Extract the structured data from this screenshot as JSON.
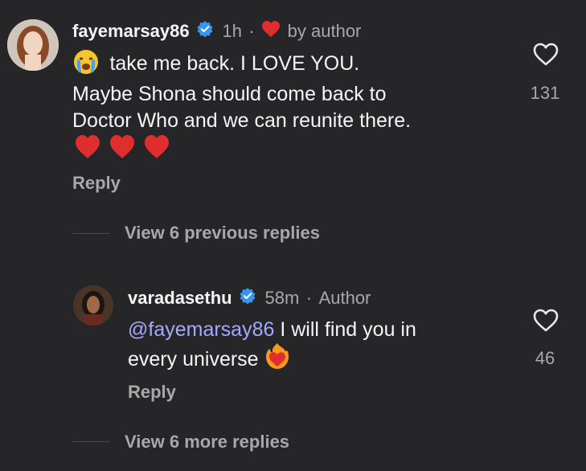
{
  "comment": {
    "username": "fayemarsay86",
    "time": "1h",
    "separator": "·",
    "liked_by_author": "by author",
    "line1": "take me back. I LOVE YOU.",
    "line2": "Maybe Shona should come back to",
    "line3": "Doctor Who and we can reunite there.",
    "like_count": "131",
    "reply_label": "Reply",
    "view_replies": "View 6 previous replies"
  },
  "reply": {
    "username": "varadasethu",
    "time": "58m",
    "separator": "·",
    "author_label": "Author",
    "mention": "@fayemarsay86",
    "text_rest": " I will find you in",
    "line2": "every universe",
    "like_count": "46",
    "reply_label": "Reply",
    "view_more": "View 6 more replies"
  },
  "colors": {
    "background": "#262628",
    "verified": "#3797f0",
    "heart_red": "#e02e2e",
    "mention": "#a3a9ff"
  },
  "icons": [
    "verified-badge-icon",
    "red-heart-icon",
    "crying-face-emoji",
    "heart-outline-icon",
    "heart-on-fire-emoji"
  ]
}
